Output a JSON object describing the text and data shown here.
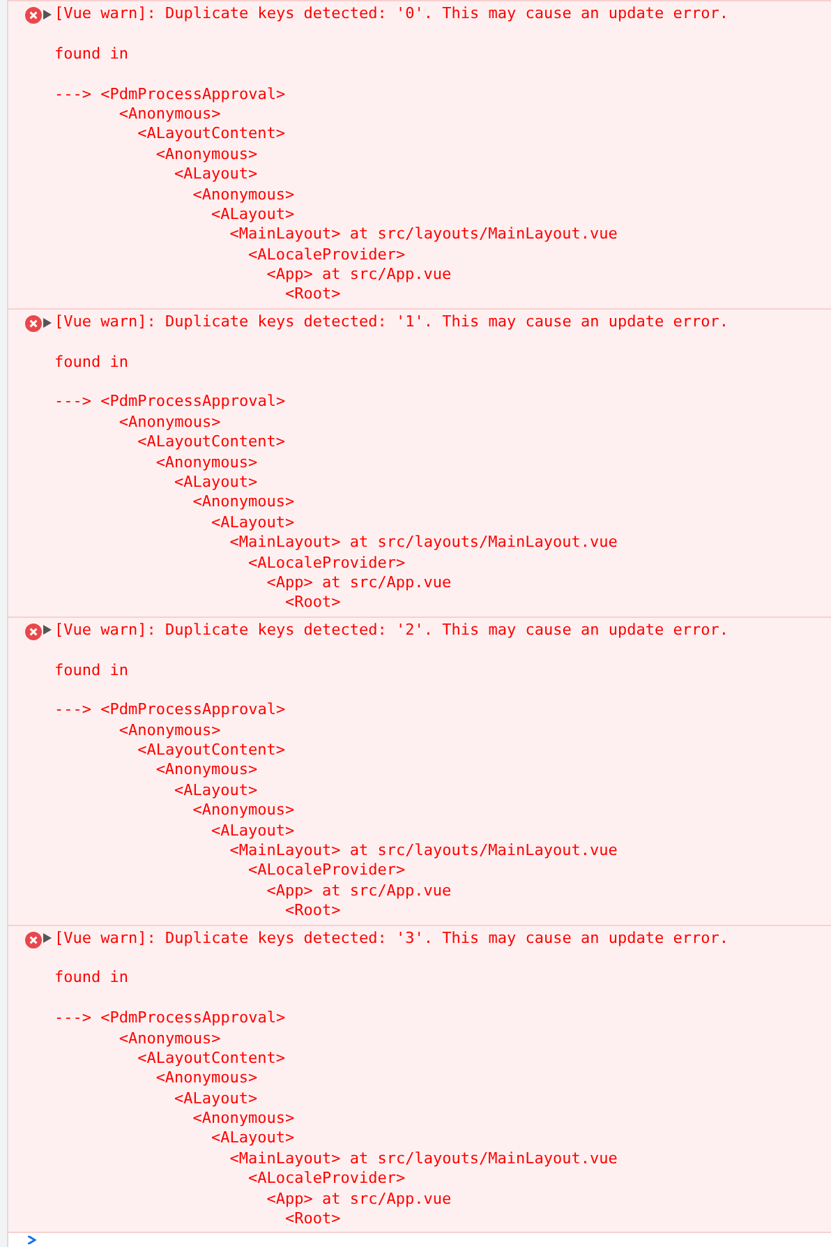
{
  "messages": [
    {
      "kind": "error",
      "expanded": false,
      "text": "[Vue warn]: Duplicate keys detected: '0'. This may cause an update error.",
      "found_in": "found in",
      "arrow": "--->",
      "trace": [
        {
          "text": "<PdmProcessApproval>",
          "children": [
            {
              "text": "<Anonymous>",
              "children": [
                {
                  "text": "<ALayoutContent>",
                  "children": [
                    {
                      "text": "<Anonymous>",
                      "children": [
                        {
                          "text": "<ALayout>",
                          "children": [
                            {
                              "text": "<Anonymous>",
                              "children": [
                                {
                                  "text": "<ALayout>",
                                  "children": [
                                    {
                                      "text": "<MainLayout> at src/layouts/MainLayout.vue",
                                      "children": [
                                        {
                                          "text": "<ALocaleProvider>",
                                          "children": [
                                            {
                                              "text": "<App> at src/App.vue",
                                              "children": [
                                                {
                                                  "text": "<Root>"
                                                }
                                              ]
                                            }
                                          ]
                                        }
                                      ]
                                    }
                                  ]
                                }
                              ]
                            }
                          ]
                        }
                      ]
                    }
                  ]
                }
              ]
            }
          ]
        }
      ]
    },
    {
      "kind": "error",
      "expanded": false,
      "text": "[Vue warn]: Duplicate keys detected: '1'. This may cause an update error.",
      "found_in": "found in",
      "arrow": "--->",
      "trace": [
        {
          "text": "<PdmProcessApproval>",
          "children": [
            {
              "text": "<Anonymous>",
              "children": [
                {
                  "text": "<ALayoutContent>",
                  "children": [
                    {
                      "text": "<Anonymous>",
                      "children": [
                        {
                          "text": "<ALayout>",
                          "children": [
                            {
                              "text": "<Anonymous>",
                              "children": [
                                {
                                  "text": "<ALayout>",
                                  "children": [
                                    {
                                      "text": "<MainLayout> at src/layouts/MainLayout.vue",
                                      "children": [
                                        {
                                          "text": "<ALocaleProvider>",
                                          "children": [
                                            {
                                              "text": "<App> at src/App.vue",
                                              "children": [
                                                {
                                                  "text": "<Root>"
                                                }
                                              ]
                                            }
                                          ]
                                        }
                                      ]
                                    }
                                  ]
                                }
                              ]
                            }
                          ]
                        }
                      ]
                    }
                  ]
                }
              ]
            }
          ]
        }
      ]
    },
    {
      "kind": "error",
      "expanded": false,
      "text": "[Vue warn]: Duplicate keys detected: '2'. This may cause an update error.",
      "found_in": "found in",
      "arrow": "--->",
      "trace": [
        {
          "text": "<PdmProcessApproval>",
          "children": [
            {
              "text": "<Anonymous>",
              "children": [
                {
                  "text": "<ALayoutContent>",
                  "children": [
                    {
                      "text": "<Anonymous>",
                      "children": [
                        {
                          "text": "<ALayout>",
                          "children": [
                            {
                              "text": "<Anonymous>",
                              "children": [
                                {
                                  "text": "<ALayout>",
                                  "children": [
                                    {
                                      "text": "<MainLayout> at src/layouts/MainLayout.vue",
                                      "children": [
                                        {
                                          "text": "<ALocaleProvider>",
                                          "children": [
                                            {
                                              "text": "<App> at src/App.vue",
                                              "children": [
                                                {
                                                  "text": "<Root>"
                                                }
                                              ]
                                            }
                                          ]
                                        }
                                      ]
                                    }
                                  ]
                                }
                              ]
                            }
                          ]
                        }
                      ]
                    }
                  ]
                }
              ]
            }
          ]
        }
      ]
    },
    {
      "kind": "error",
      "expanded": false,
      "text": "[Vue warn]: Duplicate keys detected: '3'. This may cause an update error.",
      "found_in": "found in",
      "arrow": "--->",
      "trace": [
        {
          "text": "<PdmProcessApproval>",
          "children": [
            {
              "text": "<Anonymous>",
              "children": [
                {
                  "text": "<ALayoutContent>",
                  "children": [
                    {
                      "text": "<Anonymous>",
                      "children": [
                        {
                          "text": "<ALayout>",
                          "children": [
                            {
                              "text": "<Anonymous>",
                              "children": [
                                {
                                  "text": "<ALayout>",
                                  "children": [
                                    {
                                      "text": "<MainLayout> at src/layouts/MainLayout.vue",
                                      "children": [
                                        {
                                          "text": "<ALocaleProvider>",
                                          "children": [
                                            {
                                              "text": "<App> at src/App.vue",
                                              "children": [
                                                {
                                                  "text": "<Root>"
                                                }
                                              ]
                                            }
                                          ]
                                        }
                                      ]
                                    }
                                  ]
                                }
                              ]
                            }
                          ]
                        }
                      ]
                    }
                  ]
                }
              ]
            }
          ]
        }
      ]
    }
  ]
}
